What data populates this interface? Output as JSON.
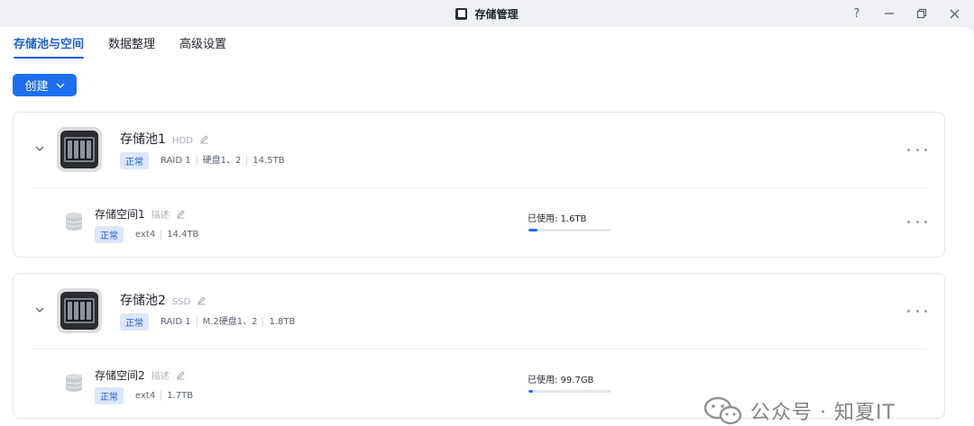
{
  "window": {
    "title": "存储管理",
    "help_glyph": "?"
  },
  "tabs": [
    {
      "label": "存储池与空间",
      "active": true
    },
    {
      "label": "数据整理",
      "active": false
    },
    {
      "label": "高级设置",
      "active": false
    }
  ],
  "create_button": {
    "label": "创建"
  },
  "pools": [
    {
      "name": "存储池1",
      "media": "HDD",
      "status": "正常",
      "raid": "RAID 1",
      "disks": "硬盘1、2",
      "capacity": "14.5TB",
      "space": {
        "name": "存储空间1",
        "desc": "描述",
        "status": "正常",
        "fs": "ext4",
        "capacity": "14.4TB",
        "used_label": "已使用: 1.6TB",
        "used_fraction": 0.11
      }
    },
    {
      "name": "存储池2",
      "media": "SSD",
      "status": "正常",
      "raid": "RAID 1",
      "disks": "M.2硬盘1、2",
      "capacity": "1.8TB",
      "space": {
        "name": "存储空间2",
        "desc": "描述",
        "status": "正常",
        "fs": "ext4",
        "capacity": "1.7TB",
        "used_label": "已使用: 99.7GB",
        "used_fraction": 0.05
      }
    }
  ],
  "watermark": {
    "text": "公众号 · 知夏IT"
  },
  "colors": {
    "accent": "#1e6ff0",
    "badge_bg": "#dbe7fb",
    "badge_text": "#1a5fd6"
  }
}
